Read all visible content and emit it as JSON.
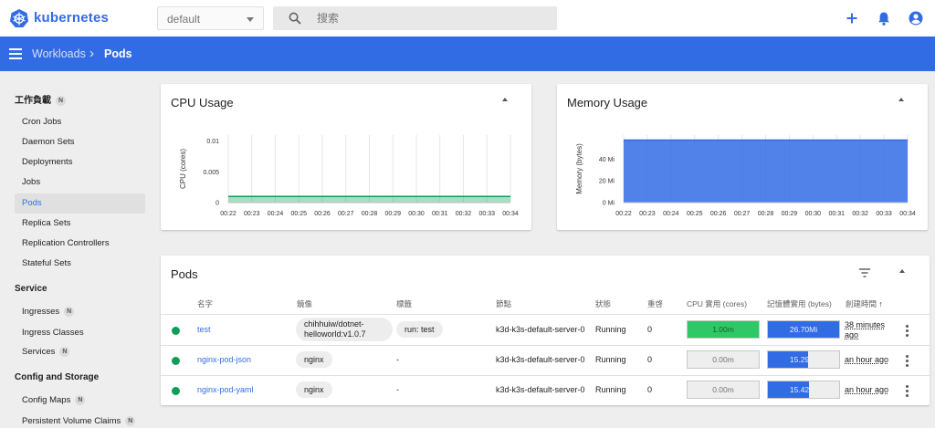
{
  "brand": {
    "name": "kubernetes",
    "color": "#326ce5"
  },
  "namespace": {
    "value": "default"
  },
  "search": {
    "placeholder": "搜索"
  },
  "topbar_icons": [
    "plus-icon",
    "bell-icon",
    "account-icon"
  ],
  "breadcrumb": {
    "parent": "Workloads",
    "current": "Pods"
  },
  "sidebar": {
    "sections": [
      {
        "title": "工作負載",
        "badge": "N",
        "items": [
          {
            "label": "Cron Jobs"
          },
          {
            "label": "Daemon Sets"
          },
          {
            "label": "Deployments"
          },
          {
            "label": "Jobs"
          },
          {
            "label": "Pods",
            "active": true
          },
          {
            "label": "Replica Sets"
          },
          {
            "label": "Replication Controllers"
          },
          {
            "label": "Stateful Sets"
          }
        ]
      },
      {
        "title": "Service",
        "items": [
          {
            "label": "Ingresses",
            "badge": "N"
          },
          {
            "label": "Ingress Classes"
          },
          {
            "label": "Services",
            "badge": "N"
          }
        ]
      },
      {
        "title": "Config and Storage",
        "items": [
          {
            "label": "Config Maps",
            "badge": "N"
          },
          {
            "label": "Persistent Volume Claims",
            "badge": "N"
          }
        ]
      }
    ]
  },
  "cpu_card": {
    "title": "CPU Usage"
  },
  "memory_card": {
    "title": "Memory Usage"
  },
  "chart_data": [
    {
      "type": "area",
      "title": "CPU Usage",
      "ylabel": "CPU (cores)",
      "xlabel": "",
      "x": [
        "00:22",
        "00:23",
        "00:24",
        "00:25",
        "00:26",
        "00:27",
        "00:28",
        "00:29",
        "00:30",
        "00:31",
        "00:32",
        "00:33",
        "00:34"
      ],
      "yticks": [
        "0",
        "0.005",
        "0.01"
      ],
      "ylim": [
        0,
        0.011
      ],
      "series": [
        {
          "values": [
            0.001,
            0.001,
            0.001,
            0.001,
            0.001,
            0.001,
            0.001,
            0.001,
            0.001,
            0.001,
            0.001,
            0.001,
            0.001
          ],
          "color": "#0f9d58"
        }
      ],
      "grid": "vertical"
    },
    {
      "type": "area",
      "title": "Memory Usage",
      "ylabel": "Memory (bytes)",
      "xlabel": "",
      "x": [
        "00:22",
        "00:23",
        "00:24",
        "00:25",
        "00:26",
        "00:27",
        "00:28",
        "00:29",
        "00:30",
        "00:31",
        "00:32",
        "00:33",
        "00:34"
      ],
      "yticks": [
        "0 Mi",
        "20 Mi",
        "40 Mi"
      ],
      "ylim": [
        0,
        62
      ],
      "series": [
        {
          "values": [
            57.4,
            57.4,
            57.4,
            57.4,
            57.4,
            57.4,
            57.4,
            57.4,
            57.4,
            57.4,
            57.4,
            57.4,
            57.4
          ],
          "color": "#326ce5"
        }
      ],
      "grid": "vertical"
    }
  ],
  "pods": {
    "title": "Pods",
    "columns": [
      "名字",
      "鏡像",
      "標籤",
      "節點",
      "狀態",
      "重啓",
      "CPU 實用 (cores)",
      "記憶體實用 (bytes)",
      "創建時間"
    ],
    "rows": [
      {
        "name": "test",
        "image": "chihhuiw/dotnet-helloworld:v1.0.7",
        "labels": "run: test",
        "node": "k3d-k3s-default-server-0",
        "status": "Running",
        "restarts": "0",
        "cpu": "1.00m",
        "cpu_fill": 1.0,
        "memory": "26.70Mi",
        "memory_fill": 1.0,
        "age": "38 minutes ago"
      },
      {
        "name": "nginx-pod-json",
        "image": "nginx",
        "labels": "-",
        "node": "k3d-k3s-default-server-0",
        "status": "Running",
        "restarts": "0",
        "cpu": "0.00m",
        "cpu_fill": 0.0,
        "memory": "15.29Mi",
        "memory_fill": 0.57,
        "age": "an hour ago"
      },
      {
        "name": "nginx-pod-yaml",
        "image": "nginx",
        "labels": "-",
        "node": "k3d-k3s-default-server-0",
        "status": "Running",
        "restarts": "0",
        "cpu": "0.00m",
        "cpu_fill": 0.0,
        "memory": "15.42Mi",
        "memory_fill": 0.58,
        "age": "an hour ago"
      }
    ]
  },
  "colors": {
    "header": "#326ce5",
    "running": "#0f9d58",
    "cpu_bar": "#2ec866",
    "memory_bar": "#326ce5"
  }
}
